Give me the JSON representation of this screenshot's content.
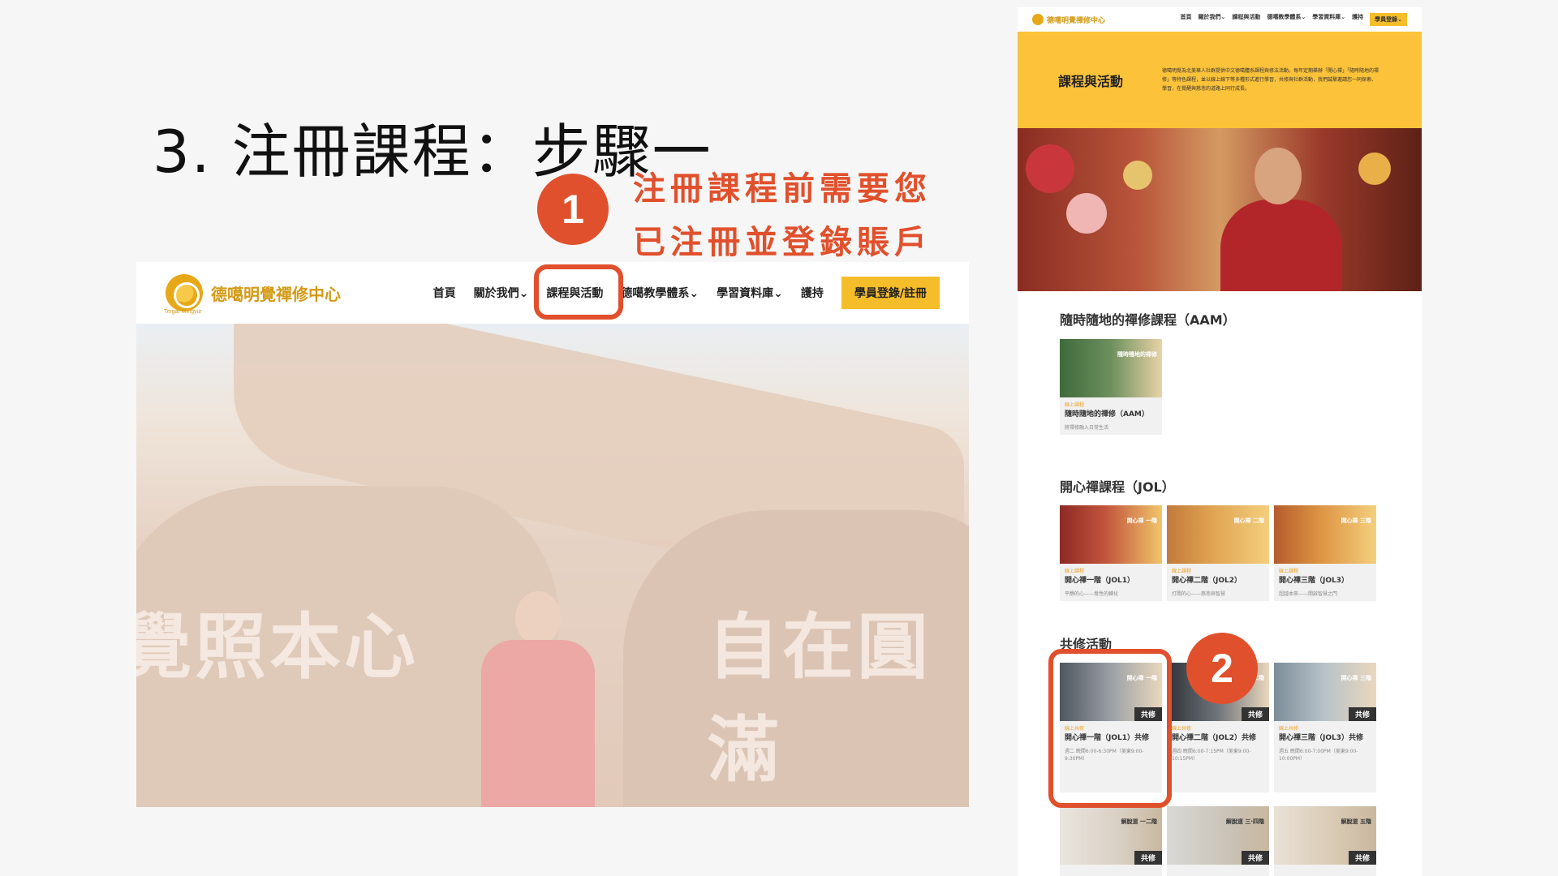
{
  "slide": {
    "title": "3. 注冊課程：步驟一",
    "note_line1": "注冊課程前需要您",
    "note_line2": "已注冊並登錄賬戶",
    "step1": "1",
    "step2": "2"
  },
  "colors": {
    "accent": "#e1502c",
    "brand_gold": "#f5bd29",
    "logo_gold": "#d39a14"
  },
  "left_site": {
    "logo_text": "德噶明覺禪修中心",
    "logo_sub": "Tergar Mingyur",
    "nav": [
      "首頁",
      "關於我們⌄",
      "課程與活動",
      "德噶教學體系⌄",
      "學習資料庫⌄",
      "護持"
    ],
    "cta": "學員登錄/註冊",
    "hero_text_left": "覺照本心",
    "hero_text_right": "自在圓滿"
  },
  "right_site": {
    "logo_text": "德噶明覺禪修中心",
    "nav": [
      "首頁",
      "關於我們⌄",
      "課程與活動",
      "德噶教學體系⌄",
      "學習資料庫⌄",
      "護持"
    ],
    "cta": "學員登錄⌄",
    "banner_title": "課程與活動",
    "banner_desc": "德噶明覺為北美華人社群提供中文德噶體系課程與修法活動。每年定期舉辦「開心禪」「隨時隨地的禪修」等特色課程，並以線上線下等多種形式進行學習，共修與社群活動，我們誠摯邀請您一同探索、學習，在覺醒與慈悲的道路上同行成長。",
    "section_aam": "隨時隨地的禪修課程（AAM）",
    "section_jol": "開心禪課程（JOL）",
    "section_practice": "共修活動",
    "aam_cards": [
      {
        "thumb": "隨時隨地的禪修",
        "cat": "線上課程",
        "name": "隨時隨地的禪修（AAM）",
        "desc": "將禪修融入日常生活"
      }
    ],
    "jol_cards": [
      {
        "thumb": "開心禪 一階",
        "cat": "線上課程",
        "name": "開心禪一階（JOL1）",
        "desc": "平靜的心——覺性的轉化"
      },
      {
        "thumb": "開心禪 二階",
        "cat": "線上課程",
        "name": "開心禪二階（JOL2）",
        "desc": "打開的心——慈悲與智慧"
      },
      {
        "thumb": "開心禪 三階",
        "cat": "線上課程",
        "name": "開心禪三階（JOL3）",
        "desc": "超越本來——開啟智慧之門"
      }
    ],
    "practice_cards": [
      {
        "thumb": "開心禪 一階",
        "tag": "共修",
        "cat": "線上共修",
        "name": "開心禪一階（JOL1）共修",
        "desc": "週二 晚間6:00-6:30PM（美東9:00-9:30PM）"
      },
      {
        "thumb": "開心禪 二階",
        "tag": "共修",
        "cat": "線上共修",
        "name": "開心禪二階（JOL2）共修",
        "desc": "週四 晚間6:00-7:15PM（美東9:00-10:15PM）"
      },
      {
        "thumb": "開心禪 三階",
        "tag": "共修",
        "cat": "線上共修",
        "name": "開心禪三階（JOL3）共修",
        "desc": "週五 晚間6:00-7:00PM（美東9:00-10:00PM）"
      }
    ],
    "release_cards": [
      {
        "thumb": "解脫道 一二階",
        "tag": "共修"
      },
      {
        "thumb": "解脫道 三·四階",
        "tag": "共修"
      },
      {
        "thumb": "解脫道 五階",
        "tag": "共修"
      }
    ]
  }
}
